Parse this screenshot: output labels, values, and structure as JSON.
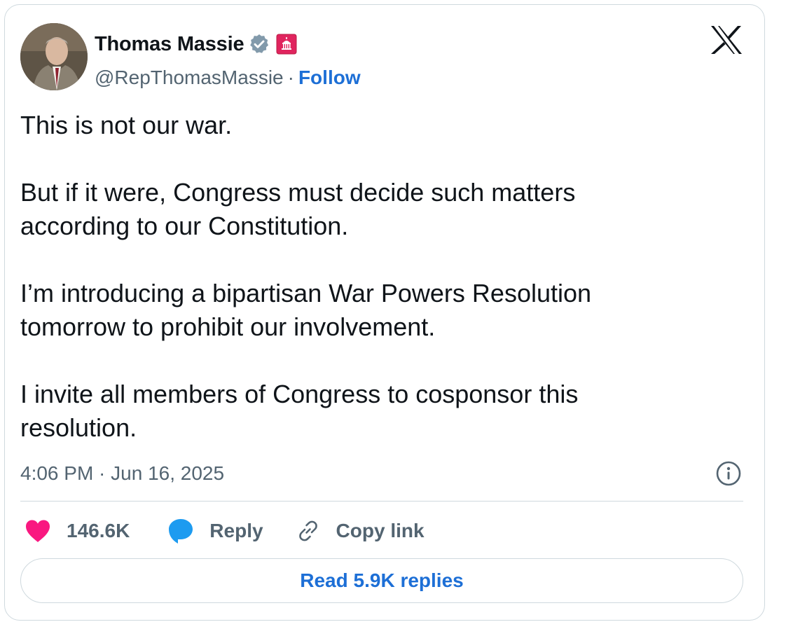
{
  "author": {
    "name": "Thomas Massie",
    "handle": "@RepThomasMassie",
    "separator": "·",
    "follow_label": "Follow",
    "avatar_icon": "profile-photo",
    "verified_icon": "verified-badge-icon",
    "affiliation_icon": "us-congress-badge-icon"
  },
  "platform": {
    "logo_icon": "x-logo-icon"
  },
  "tweet": {
    "paragraphs": [
      "This is not our war.",
      "But if it were, Congress must decide such matters\naccording to our Constitution.",
      "I’m introducing a bipartisan War Powers Resolution\ntomorrow to prohibit our involvement.",
      "I invite all members of Congress to cosponsor this\nresolution."
    ],
    "timestamp": "4:06 PM · Jun 16, 2025"
  },
  "actions": {
    "like_count": "146.6K",
    "reply_label": "Reply",
    "copy_link_label": "Copy link",
    "read_replies_label": "Read 5.9K replies"
  },
  "colors": {
    "accent": "#1d6fd6",
    "like": "#f91880",
    "reply_icon": "#1d9bf0",
    "verified": "#829aab",
    "affiliation": "#e0245e",
    "muted_text": "#536471",
    "border": "#cfd9de"
  }
}
